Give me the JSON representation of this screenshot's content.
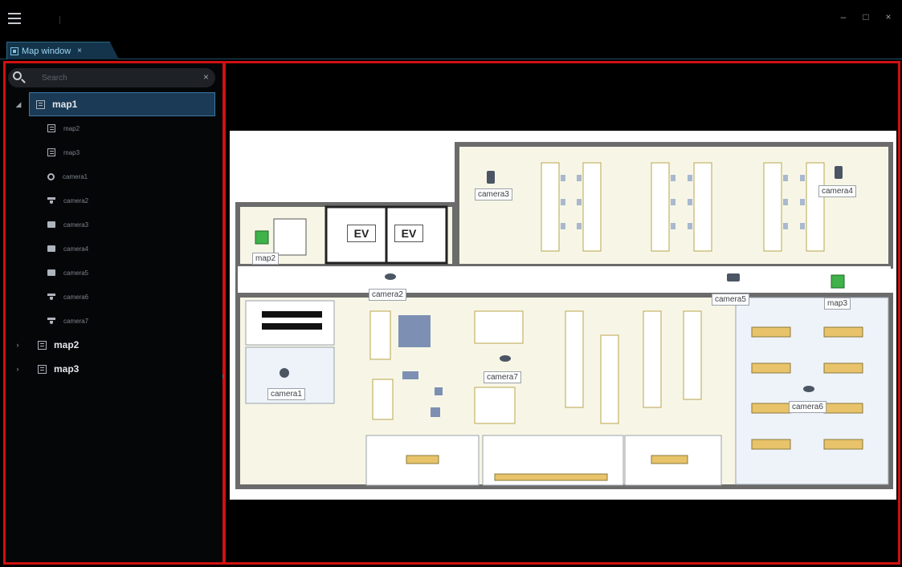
{
  "window": {
    "minimize_glyph": "–",
    "maximize_glyph": "□",
    "close_glyph": "×",
    "menu_icon": "hamburger-icon"
  },
  "tab": {
    "label": "Map window",
    "close_glyph": "×",
    "icon": "map-window-icon"
  },
  "search": {
    "placeholder": "Search",
    "clear_glyph": "×",
    "icon": "search-icon"
  },
  "tree": {
    "root_open": {
      "label": "map1",
      "expander": "◢",
      "children": [
        {
          "label": "map2",
          "icon": "map-icon"
        },
        {
          "label": "map3",
          "icon": "map-icon"
        },
        {
          "label": "camera1",
          "icon": "ptz-camera-icon"
        },
        {
          "label": "camera2",
          "icon": "dome-camera-icon"
        },
        {
          "label": "camera3",
          "icon": "box-camera-icon"
        },
        {
          "label": "camera4",
          "icon": "box-camera-icon"
        },
        {
          "label": "camera5",
          "icon": "box-camera-icon"
        },
        {
          "label": "camera6",
          "icon": "dome-camera-icon"
        },
        {
          "label": "camera7",
          "icon": "dome-camera-icon"
        }
      ]
    },
    "root_closed": [
      {
        "label": "map2",
        "expander": "›"
      },
      {
        "label": "map3",
        "expander": "›"
      }
    ]
  },
  "floor_plan": {
    "ev_left": "EV",
    "ev_right": "EV",
    "labels": {
      "map2": "map2",
      "map3": "map3",
      "camera1": "camera1",
      "camera2": "camera2",
      "camera3": "camera3",
      "camera4": "camera4",
      "camera5": "camera5",
      "camera6": "camera6",
      "camera7": "camera7"
    }
  },
  "colors": {
    "highlight_border": "#d01010",
    "selection_fill": "#1b3a55",
    "floor_fill": "#f7f6e6",
    "meeting_room_fill": "#eef3fa",
    "wall": "#6b6b6b"
  }
}
